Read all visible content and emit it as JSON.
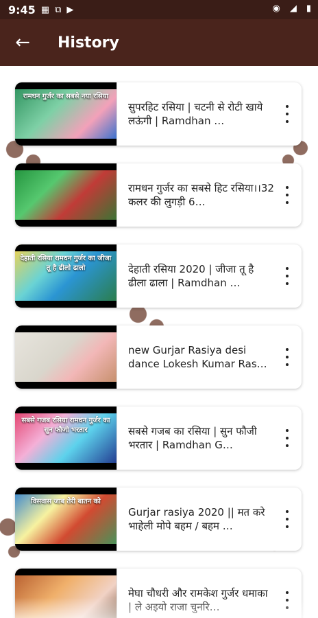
{
  "status": {
    "time": "9:45",
    "icons": [
      "mail-icon",
      "cast-icon",
      "play-icon"
    ],
    "right_icons": [
      "wifi-icon",
      "signal-icon",
      "battery-icon"
    ]
  },
  "appbar": {
    "back_icon": "back-arrow-icon",
    "title": "History"
  },
  "items": [
    {
      "title": "सुपरहिट रसिया | चटनी से रोटी खाये लऊंगी | Ramdhan …",
      "thumb_text": "रामधन गुर्जर का सबसे नया रसिया"
    },
    {
      "title": "रामधन गुर्जर का सबसे हिट रसिया।।32 कलर की लुगड़ी 6…",
      "thumb_text": ""
    },
    {
      "title": "देहाती रसिया 2020 | जीजा तू है ढीला ढाला | Ramdhan …",
      "thumb_text": "देहाती रसिया रामधन गुर्जर का जीजा तू है ढीलो ढालो"
    },
    {
      "title": "new Gurjar Rasiya desi dance Lokesh Kumar Ras…",
      "thumb_text": ""
    },
    {
      "title": "सबसे गजब का रसिया | सुन फौजी भरतार | Ramdhan G…",
      "thumb_text": "सबसे गजब रसिया रामधन गुर्जर का सुन फौजी भरतार"
    },
    {
      "title": "Gurjar rasiya 2020 || मत करे भाहेली मोपे बहम / बहम …",
      "thumb_text": "विसवास जाब तेरी बातन को"
    },
    {
      "title": "मेघा चौधरी और रामकेश गुर्जर धमाका | ले अइयो राजा चुनरि…",
      "thumb_text": ""
    }
  ]
}
